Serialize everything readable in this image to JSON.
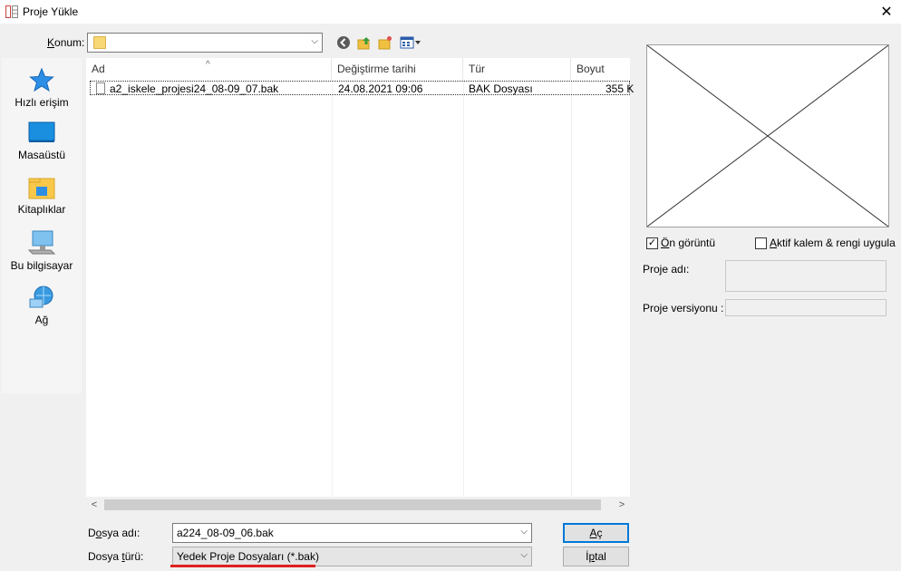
{
  "window": {
    "title": "Proje Yükle",
    "close_glyph": "✕"
  },
  "location": {
    "label_prefix": "",
    "label_accel": "K",
    "label_rest": "onum:",
    "value": ""
  },
  "places": [
    {
      "label": "Hızlı erişim",
      "icon": "star-icon"
    },
    {
      "label": "Masaüstü",
      "icon": "desktop-icon"
    },
    {
      "label": "Kitaplıklar",
      "icon": "libraries-icon"
    },
    {
      "label": "Bu bilgisayar",
      "icon": "computer-icon"
    },
    {
      "label": "Ağ",
      "icon": "network-icon"
    }
  ],
  "columns": {
    "name": "Ad",
    "modified": "Değiştirme tarihi",
    "type": "Tür",
    "size": "Boyut"
  },
  "files": [
    {
      "name": "a2_iskele_projesi24_08-09_07.bak",
      "modified": "24.08.2021 09:06",
      "type": "BAK Dosyası",
      "size": "355 K"
    }
  ],
  "filename": {
    "label_prefix": "D",
    "label_accel": "o",
    "label_rest": "sya adı:",
    "value": "a224_08-09_06.bak"
  },
  "filetype": {
    "label_prefix": "Dosya ",
    "label_accel": "t",
    "label_rest": "ürü:",
    "value": "Yedek Proje Dosyaları (*.bak)"
  },
  "buttons": {
    "open_accel": "A",
    "open_rest": "ç",
    "cancel_prefix": "İ",
    "cancel_accel": "p",
    "cancel_rest": "tal"
  },
  "preview": {
    "show_preview_prefix": "",
    "show_preview_accel": "Ö",
    "show_preview_rest": "n görüntü",
    "show_preview_checked": true,
    "active_pen_prefix": "",
    "active_pen_accel": "A",
    "active_pen_rest": "ktif kalem & rengi uygula",
    "active_pen_checked": false,
    "project_name_label": "Proje adı:",
    "project_version_label": "Proje versiyonu :"
  },
  "colors": {
    "accent": "#0078d7",
    "underline_red": "#e02020"
  }
}
